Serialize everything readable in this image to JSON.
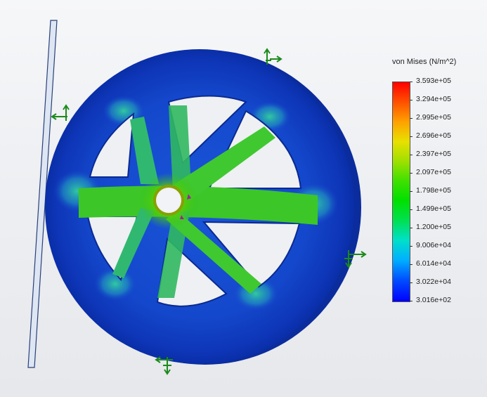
{
  "legend": {
    "title": "von Mises (N/m^2)",
    "ticks": [
      "3.593e+05",
      "3.294e+05",
      "2.995e+05",
      "2.696e+05",
      "2.397e+05",
      "2.097e+05",
      "1.798e+05",
      "1.499e+05",
      "1.200e+05",
      "9.006e+04",
      "6.014e+04",
      "3.022e+04",
      "3.016e+02"
    ]
  },
  "colors": {
    "max": "#ff0000",
    "mid": "#00e000",
    "min": "#0000ff",
    "fixture_arrows": "#1a8a1a",
    "background": "#eef0f3"
  },
  "icons": {
    "fixture": "fixture-arrow-icon"
  }
}
